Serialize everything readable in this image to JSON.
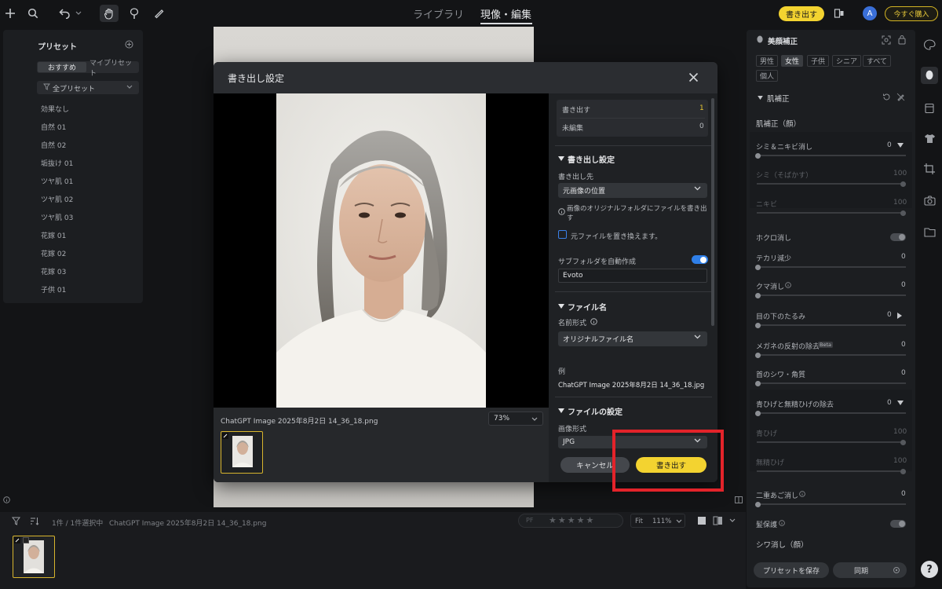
{
  "topbar": {
    "tabs": [
      "ライブラリ",
      "現像・編集"
    ],
    "export_button": "書き出す",
    "buy_button": "今すぐ購入",
    "avatar_letter": "A"
  },
  "presets": {
    "title": "プリセット",
    "tabs": [
      "おすすめ",
      "マイプリセット"
    ],
    "filter": "全プリセット",
    "items": [
      "効果なし",
      "自然 01",
      "自然 02",
      "垢抜け 01",
      "ツヤ肌 01",
      "ツヤ肌 02",
      "ツヤ肌 03",
      "花嫁 01",
      "花嫁 02",
      "花嫁 03",
      "子供 01"
    ]
  },
  "dialog": {
    "title": "書き出し設定",
    "filename": "ChatGPT Image 2025年8月2日 14_36_18.png",
    "zoom": "73%",
    "summary": [
      {
        "label": "書き出す",
        "value": "1"
      },
      {
        "label": "未編集",
        "value": "0"
      }
    ],
    "export_settings": {
      "heading": "書き出し設定",
      "destination_label": "書き出し先",
      "destination_value": "元画像の位置",
      "info_text": "画像のオリジナルフォルダにファイルを書き出す",
      "overwrite_label": "元ファイルを置き換えます。",
      "subfolder_label": "サブフォルダを自動作成",
      "subfolder_value": "Evoto"
    },
    "file_name": {
      "heading": "ファイル名",
      "format_label": "名前形式",
      "format_value": "オリジナルファイル名",
      "example_label": "例",
      "example_value": "ChatGPT Image 2025年8月2日 14_36_18.jpg"
    },
    "file_settings": {
      "heading": "ファイルの設定",
      "format_label": "画像形式",
      "format_value": "JPG"
    },
    "cancel_button": "キャンセル",
    "export_button": "書き出す"
  },
  "right_panel": {
    "title": "美顔補正",
    "gender_tags": [
      "男性",
      "女性",
      "子供",
      "シニア",
      "すべて",
      "個人"
    ],
    "section": "肌補正",
    "subsection": "肌補正（顔）",
    "rows": [
      {
        "label": "シミ＆ニキビ消し",
        "value": "0"
      },
      {
        "label": "シミ（そばかす）",
        "value": "100"
      },
      {
        "label": "ニキビ",
        "value": "100"
      },
      {
        "label": "ホクロ消し",
        "value": ""
      },
      {
        "label": "テカリ減少",
        "value": "0"
      },
      {
        "label": "クマ消し",
        "value": "0"
      },
      {
        "label": "目の下のたるみ",
        "value": "0"
      },
      {
        "label": "メガネの反射の除去",
        "value": "0",
        "badge": "Beta"
      },
      {
        "label": "首のシワ・角質",
        "value": "0"
      },
      {
        "label": "青ひげと無精ひげの除去",
        "value": "0"
      },
      {
        "label": "青ひげ",
        "value": "100"
      },
      {
        "label": "無精ひげ",
        "value": "100"
      },
      {
        "label": "二重あご消し",
        "value": "0"
      },
      {
        "label": "髪保護",
        "value": ""
      }
    ],
    "wrinkle_section": "シワ消し（顔）",
    "save_preset": "プリセットを保存",
    "sync": "同期"
  },
  "bottom": {
    "selection": "1件 / 1件選択中",
    "filename": "ChatGPT Image 2025年8月2日 14_36_18.png",
    "fit": "Fit",
    "zoom": "111%",
    "flag_label": "PF"
  },
  "colors": {
    "accent_yellow": "#f3d330",
    "toggle_blue": "#2f7fe8",
    "highlight_red": "#e3232a"
  }
}
